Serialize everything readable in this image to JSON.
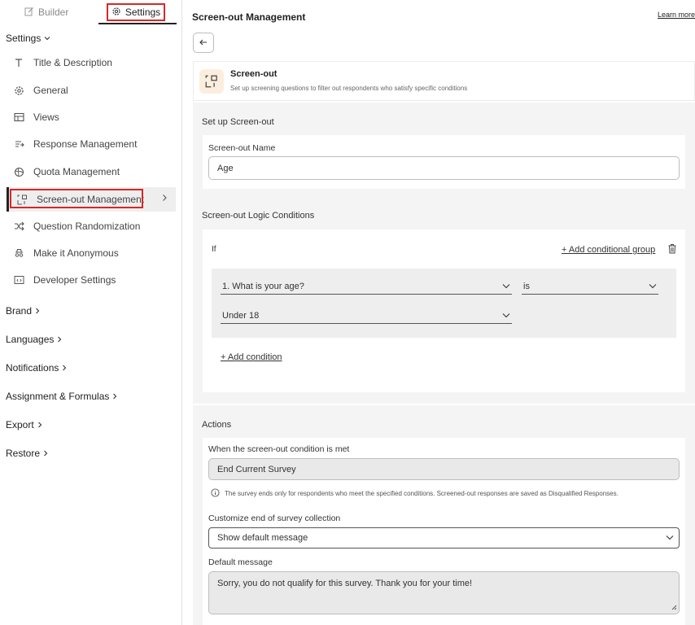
{
  "tabs": {
    "builder": "Builder",
    "settings": "Settings"
  },
  "sidebar": {
    "settings_section": "Settings",
    "items": [
      {
        "label": "Title & Description",
        "icon": "text-t-icon"
      },
      {
        "label": "General",
        "icon": "gear-icon"
      },
      {
        "label": "Views",
        "icon": "layout-icon"
      },
      {
        "label": "Response Management",
        "icon": "response-icon"
      },
      {
        "label": "Quota Management",
        "icon": "globe-icon"
      },
      {
        "label": "Screen-out Management",
        "icon": "screenout-icon",
        "active": true
      },
      {
        "label": "Question Randomization",
        "icon": "shuffle-icon"
      },
      {
        "label": "Make it Anonymous",
        "icon": "incognito-icon"
      },
      {
        "label": "Developer Settings",
        "icon": "code-icon"
      }
    ],
    "sections": [
      "Brand",
      "Languages",
      "Notifications",
      "Assignment & Formulas",
      "Export",
      "Restore"
    ]
  },
  "main": {
    "title": "Screen-out Management",
    "learn_more": "Learn more",
    "card": {
      "title": "Screen-out",
      "subtitle": "Set up screening questions to filter out respondents who satisfy specific conditions"
    },
    "setup": {
      "heading": "Set up Screen-out",
      "name_label": "Screen-out Name",
      "name_value": "Age"
    },
    "logic": {
      "heading": "Screen-out Logic Conditions",
      "if_label": "If",
      "add_group": "+ Add conditional group",
      "question": "1. What is your age?",
      "operator": "is",
      "value": "Under 18",
      "add_condition": "+ Add condition"
    },
    "actions": {
      "heading": "Actions",
      "when_label": "When the screen-out condition is met",
      "when_value": "End Current Survey",
      "info": "The survey ends only for respondents who meet the specified conditions. Screened-out responses are saved as Disqualified Responses.",
      "customize_label": "Customize end of survey collection",
      "customize_value": "Show default message",
      "default_label": "Default message",
      "default_value": "Sorry, you do not qualify for this survey. Thank you for your time!"
    }
  },
  "colors": {
    "highlight": "#d62828",
    "accent_bg": "#fbeede",
    "panel_bg": "#f4f4f4"
  }
}
